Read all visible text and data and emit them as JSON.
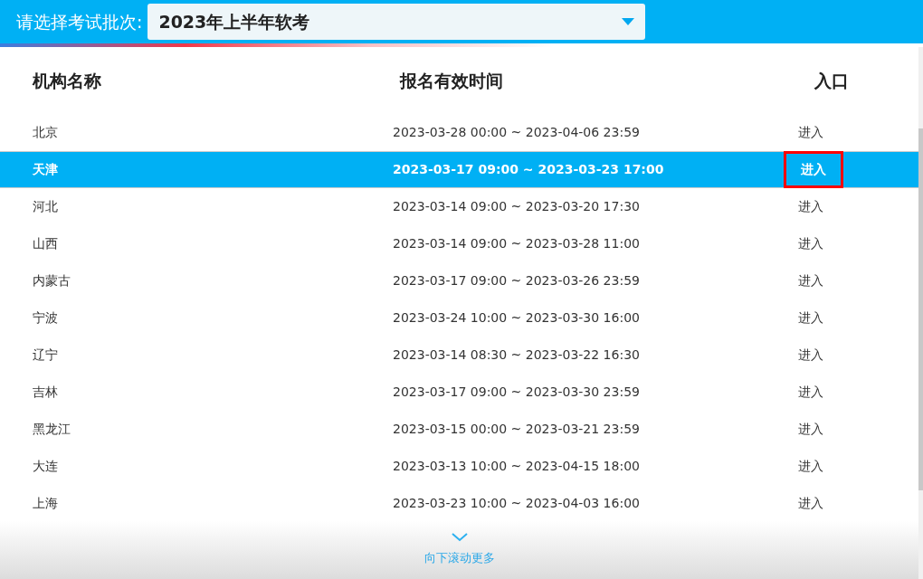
{
  "batch_selector": {
    "label": "请选择考试批次:",
    "value": "2023年上半年软考"
  },
  "table": {
    "columns": [
      "机构名称",
      "报名有效时间",
      "入口"
    ],
    "rows": [
      {
        "name": "北京",
        "period": "2023-03-28 00:00 ~ 2023-04-06 23:59",
        "entry": "进入",
        "selected": false,
        "entry_highlighted": false
      },
      {
        "name": "天津",
        "period": "2023-03-17 09:00 ~ 2023-03-23 17:00",
        "entry": "进入",
        "selected": true,
        "entry_highlighted": true
      },
      {
        "name": "河北",
        "period": "2023-03-14 09:00 ~ 2023-03-20 17:30",
        "entry": "进入",
        "selected": false,
        "entry_highlighted": false
      },
      {
        "name": "山西",
        "period": "2023-03-14 09:00 ~ 2023-03-28 11:00",
        "entry": "进入",
        "selected": false,
        "entry_highlighted": false
      },
      {
        "name": "内蒙古",
        "period": "2023-03-17 09:00 ~ 2023-03-26 23:59",
        "entry": "进入",
        "selected": false,
        "entry_highlighted": false
      },
      {
        "name": "宁波",
        "period": "2023-03-24 10:00 ~ 2023-03-30 16:00",
        "entry": "进入",
        "selected": false,
        "entry_highlighted": false
      },
      {
        "name": "辽宁",
        "period": "2023-03-14 08:30 ~ 2023-03-22 16:30",
        "entry": "进入",
        "selected": false,
        "entry_highlighted": false
      },
      {
        "name": "吉林",
        "period": "2023-03-17 09:00 ~ 2023-03-30 23:59",
        "entry": "进入",
        "selected": false,
        "entry_highlighted": false
      },
      {
        "name": "黑龙江",
        "period": "2023-03-15 00:00 ~ 2023-03-21 23:59",
        "entry": "进入",
        "selected": false,
        "entry_highlighted": false
      },
      {
        "name": "大连",
        "period": "2023-03-13 10:00 ~ 2023-04-15 18:00",
        "entry": "进入",
        "selected": false,
        "entry_highlighted": false
      },
      {
        "name": "上海",
        "period": "2023-03-23 10:00 ~ 2023-04-03 16:00",
        "entry": "进入",
        "selected": false,
        "entry_highlighted": false
      }
    ]
  },
  "scroll_hint": "向下滚动更多"
}
